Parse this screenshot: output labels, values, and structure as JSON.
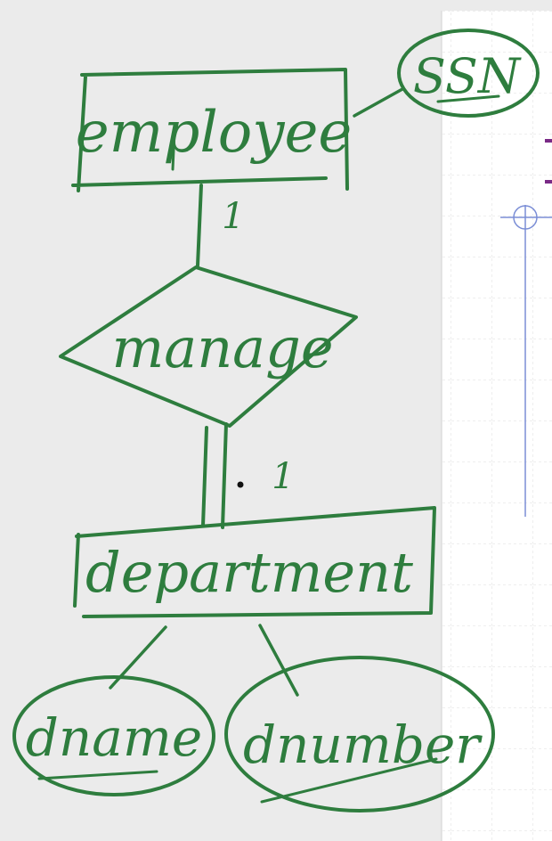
{
  "diagram": {
    "ink_color": "#2e7d3e",
    "paper_color": "#ffffff",
    "grid_color": "#dcdcdc",
    "cursor_color": "#7b8ed6",
    "entities": {
      "employee": "employee",
      "department": "department"
    },
    "relationship": "manage",
    "attributes": {
      "ssn": "SSN",
      "dname": "dname",
      "dnumber": "dnumber"
    },
    "cardinality": {
      "employee_side": "1",
      "department_side": "1"
    }
  }
}
